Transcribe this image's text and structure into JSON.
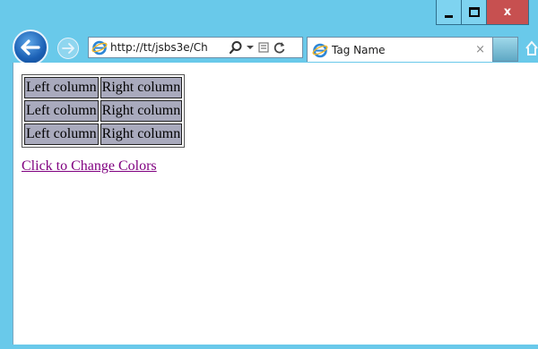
{
  "window": {
    "minimize_glyph": "",
    "close_glyph": "x"
  },
  "toolbar": {
    "address": "http://tt/jsbs3e/Ch",
    "tab_title": "Tag Name",
    "tab_close": "×"
  },
  "icons": {
    "back": "back-arrow-icon",
    "forward": "forward-arrow-icon",
    "ie": "ie-logo-icon",
    "search": "search-icon",
    "dropdown": "dropdown-arrow-icon",
    "compat": "compatibility-view-icon",
    "refresh": "refresh-icon",
    "home": "home-icon"
  },
  "colors": {
    "frame": "#69c9ea",
    "close": "#c75050",
    "cell_bg": "#a9aabd",
    "link": "#800080"
  },
  "page": {
    "table": {
      "rows": [
        [
          "Left column",
          "Right column"
        ],
        [
          "Left column",
          "Right column"
        ],
        [
          "Left column",
          "Right column"
        ]
      ]
    },
    "link_text": "Click to Change Colors"
  }
}
